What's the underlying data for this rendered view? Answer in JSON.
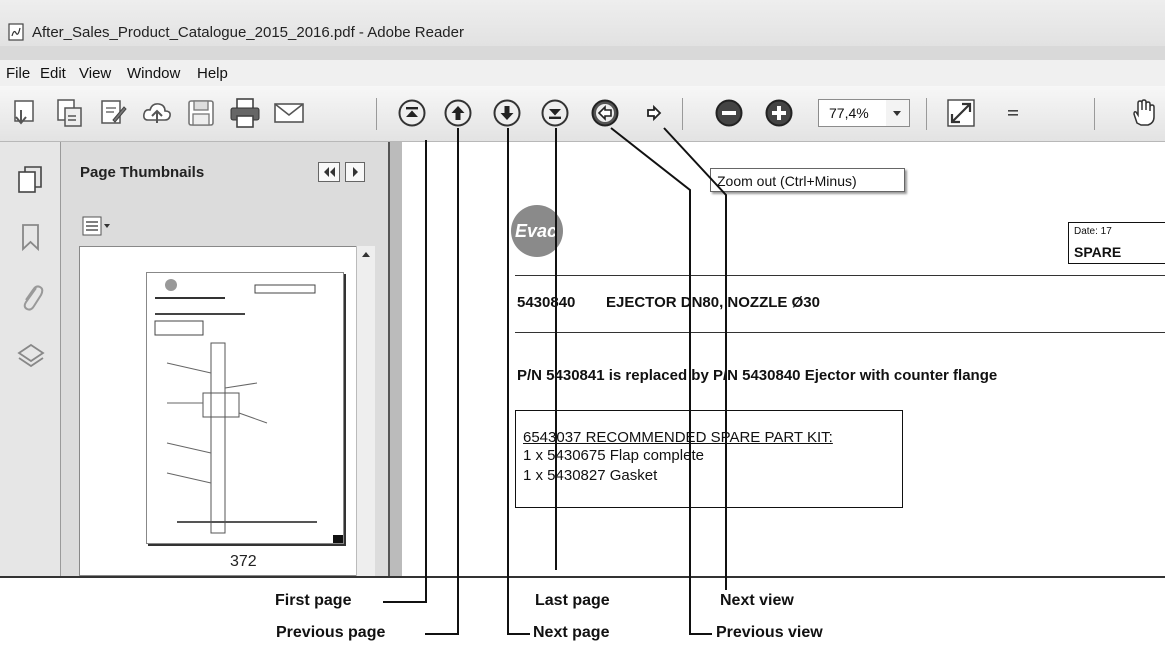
{
  "window": {
    "title": "After_Sales_Product_Catalogue_2015_2016.pdf - Adobe Reader"
  },
  "menu": [
    "File",
    "Edit",
    "View",
    "Window",
    "Help"
  ],
  "toolbar": {
    "zoom_value": "77,4%",
    "tooltip": "Zoom out (Ctrl+Minus)",
    "icons": [
      "create-pdf-icon",
      "convert-icon",
      "sign-icon",
      "cloud-upload-icon",
      "save-icon",
      "print-icon",
      "email-icon",
      "first-page-icon",
      "previous-page-icon",
      "next-page-icon",
      "last-page-icon",
      "previous-view-icon",
      "next-view-icon",
      "zoom-out-icon",
      "zoom-in-icon",
      "zoom-dropdown-icon",
      "fit-page-icon",
      "more-tools-icon",
      "hand-tool-icon"
    ]
  },
  "sidebar": {
    "title": "Page Thumbnails",
    "thumbnail_page_label": "372",
    "nav_icons": [
      "pages-icon",
      "bookmark-icon",
      "attachment-icon",
      "layers-icon"
    ]
  },
  "document": {
    "logo_text": "Evac",
    "date_label": "Date:  17",
    "spare_label": "SPARE",
    "part_number": "5430840",
    "part_title": "EJECTOR DN80, NOZZLE Ø30",
    "replacement_note": "P/N 5430841 is replaced by P/N 5430840 Ejector with counter flange",
    "kit_title": "6543037 RECOMMENDED SPARE PART KIT:",
    "kit_items": [
      "1 x 5430675 Flap complete",
      "1 x 5430827 Gasket"
    ]
  },
  "callouts": {
    "first_page": "First page",
    "previous_page": "Previous page",
    "last_page": "Last page",
    "next_page": "Next page",
    "next_view": "Next view",
    "previous_view": "Previous view"
  }
}
